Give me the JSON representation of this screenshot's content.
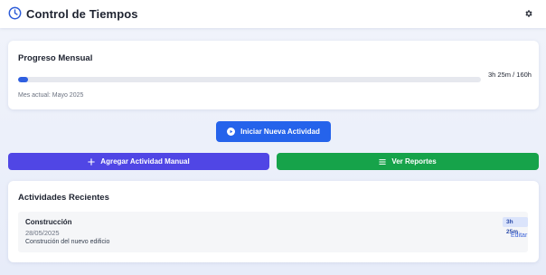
{
  "header": {
    "title": "Control de Tiempos",
    "logo_icon": "clock-icon",
    "settings_icon": "gear-icon"
  },
  "progress": {
    "title": "Progreso Mensual",
    "value_text": "3h 25m / 160h",
    "percent": 2.1,
    "subtitle": "Mes actual: Mayo 2025"
  },
  "actions": {
    "start": {
      "label": "Iniciar Nueva Actividad",
      "icon": "play-circle-icon"
    },
    "manual": {
      "label": "Agregar Actividad Manual",
      "icon": "plus-icon"
    },
    "reports": {
      "label": "Ver Reportes",
      "icon": "menu-icon"
    }
  },
  "recent": {
    "title": "Actividades Recientes",
    "items": [
      {
        "name": "Construcción",
        "date": "28/05/2025",
        "description": "Construción del nuevo edificio",
        "duration": "3h 25m",
        "edit_label": "Editar"
      }
    ]
  },
  "colors": {
    "accent_blue": "#2563eb",
    "indigo": "#5046e5",
    "green": "#16a34a",
    "progress_fill": "#2f5fe0"
  }
}
